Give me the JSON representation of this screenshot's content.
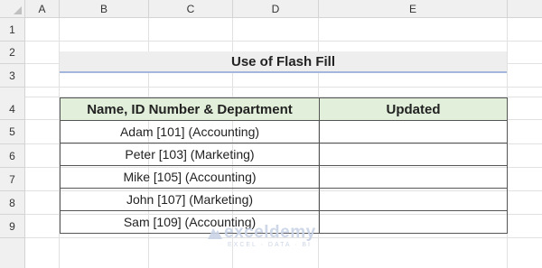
{
  "columns": [
    "A",
    "B",
    "C",
    "D",
    "E"
  ],
  "rows": [
    "1",
    "2",
    "3",
    "4",
    "5",
    "6",
    "7",
    "8",
    "9"
  ],
  "title": "Use of Flash Fill",
  "table": {
    "headers": [
      "Name, ID Number & Department",
      "Updated"
    ],
    "rows": [
      [
        "Adam [101] (Accounting)",
        ""
      ],
      [
        "Peter [103] (Marketing)",
        ""
      ],
      [
        "Mike [105] (Accounting)",
        ""
      ],
      [
        "John [107] (Marketing)",
        ""
      ],
      [
        "Sam [109] (Accounting)",
        ""
      ]
    ]
  },
  "watermark": {
    "name": "exceldemy",
    "tagline": "EXCEL · DATA · BI"
  },
  "colors": {
    "header_fill": "#e2efda",
    "title_fill": "#eeeeee",
    "title_underline": "#a5b6dc",
    "watermark": "#c8d3e6"
  },
  "icons": {
    "watermark_logo": "exceldemy-logo-icon"
  }
}
